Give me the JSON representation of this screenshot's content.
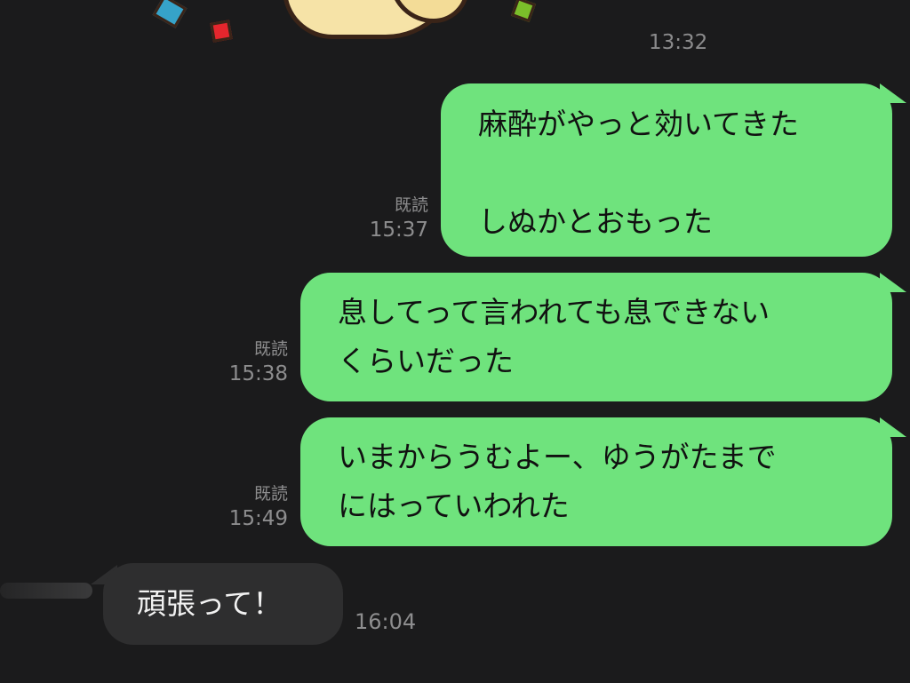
{
  "chat": {
    "top_timestamp": "13:32",
    "messages": [
      {
        "direction": "out",
        "read_label": "既読",
        "time": "15:37",
        "lines": [
          "麻酔がやっと効いてきた",
          "",
          "しぬかとおもった"
        ]
      },
      {
        "direction": "out",
        "read_label": "既読",
        "time": "15:38",
        "lines": [
          "息してって言われても息できない",
          "くらいだった"
        ]
      },
      {
        "direction": "out",
        "read_label": "既読",
        "time": "15:49",
        "lines": [
          "いまからうむよー、ゆうがたまで",
          "にはっていわれた"
        ]
      },
      {
        "direction": "in",
        "time": "16:04",
        "lines": [
          "頑張って！"
        ]
      }
    ]
  },
  "colors": {
    "background": "#1b1b1c",
    "outgoing_bubble": "#6fe37d",
    "incoming_bubble": "#2e2e2f",
    "meta_text": "#8d8d8e"
  }
}
